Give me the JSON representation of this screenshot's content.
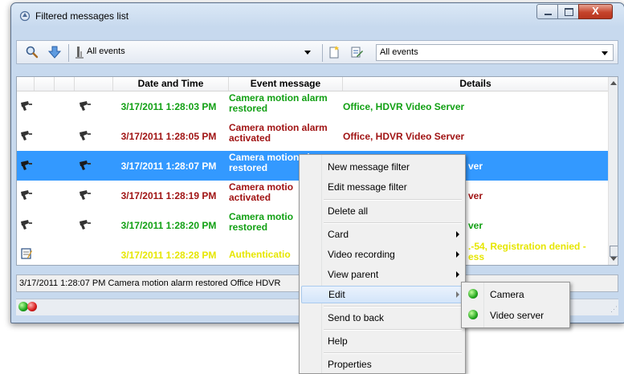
{
  "window": {
    "title": "Filtered messages list",
    "controls": {
      "minimize": "minimize",
      "maximize": "maximize",
      "close": "X"
    }
  },
  "toolbar": {
    "filter_combo_value": "All events",
    "second_combo_value": "All events",
    "icons": [
      "search-icon",
      "down-arrow-icon",
      "filter-icon",
      "new-filter-icon",
      "edit-filter-icon"
    ]
  },
  "grid": {
    "columns": [
      "",
      "",
      "",
      "Date and Time",
      "Event message",
      "Details"
    ],
    "rows": [
      {
        "date": "3/17/2011 1:28:03 PM",
        "message": [
          "Camera motion alarm",
          "restored"
        ],
        "details": "Office, HDVR Video Server",
        "color": "green",
        "selected": false
      },
      {
        "date": "3/17/2011 1:28:05 PM",
        "message": [
          "Camera motion alarm",
          "activated"
        ],
        "details": "Office, HDVR Video Server",
        "color": "red",
        "selected": false
      },
      {
        "date": "3/17/2011 1:28:07 PM",
        "message": [
          "Camera motion alarm",
          "restored"
        ],
        "details": "ver",
        "color": "white",
        "selected": true
      },
      {
        "date": "3/17/2011 1:28:19 PM",
        "message": [
          "Camera motio",
          "activated"
        ],
        "details": "ver",
        "color": "red",
        "selected": false
      },
      {
        "date": "3/17/2011 1:28:20 PM",
        "message": [
          "Camera motio",
          "restored"
        ],
        "details": "ver",
        "color": "green",
        "selected": false
      },
      {
        "date": "3/17/2011 1:28:28 PM",
        "message": [
          "Authenticatio",
          ""
        ],
        "details": ".-54, Registration denied -",
        "details2": "ess",
        "color": "yellow",
        "selected": false
      }
    ]
  },
  "status": {
    "text": "3/17/2011 1:28:07 PM  Camera motion alarm restored  Office  HDVR"
  },
  "context_menu": {
    "items": [
      {
        "label": "New message filter"
      },
      {
        "label": "Edit message filter"
      },
      {
        "label": "Delete all"
      },
      {
        "label": "Card",
        "submenu": true
      },
      {
        "label": "Video recording",
        "submenu": true
      },
      {
        "label": "View parent",
        "submenu": true
      },
      {
        "label": "Edit",
        "submenu": true,
        "highlighted": true
      },
      {
        "label": "Send to back"
      },
      {
        "label": "Help"
      },
      {
        "label": "Properties"
      }
    ]
  },
  "submenu": {
    "items": [
      {
        "label": "Camera"
      },
      {
        "label": "Video server"
      }
    ]
  },
  "colors": {
    "green": "#12a014",
    "red": "#a01414",
    "yellow": "#e6e600",
    "selection": "#3399ff"
  }
}
